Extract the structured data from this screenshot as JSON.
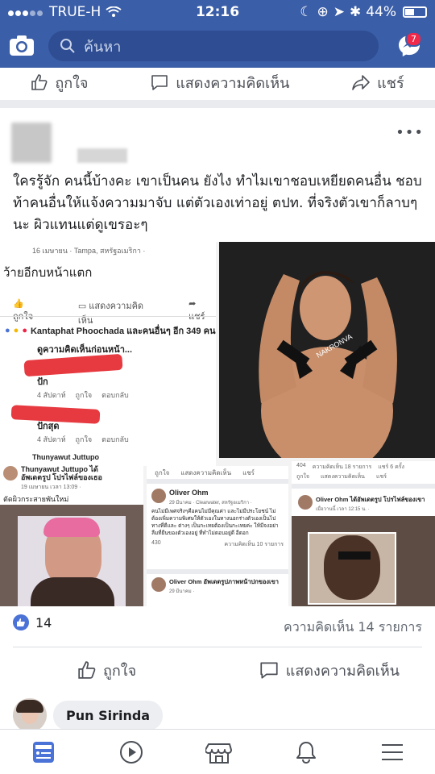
{
  "status": {
    "carrier": "TRUE-H",
    "time": "12:16",
    "battery": "44%"
  },
  "header": {
    "search_placeholder": "ค้นหา",
    "messenger_badge": "7"
  },
  "prev_post_actions": {
    "like": "ถูกใจ",
    "comment": "แสดงความคิดเห็น",
    "share": "แชร์"
  },
  "post": {
    "text": "ใครรู้จัก คนนี้บ้างคะ เขาเป็นคน ยังไง ทำไมเขาชอบเหยียดคนอื่น ชอบท้าคนอื่นให้แจ้งความมาจับ แต่ตัวเองเท่าอยู่ ตปท. ที่จริงตัวเขาก็ลาบๆนะ ผิวแทนแต่ดูเขรอะๆ",
    "more": "•••"
  },
  "collage": {
    "p1_meta": "16 เมษายน · Tampa, สหรัฐอเมริกา ·",
    "p1_text": "ว้ายอีกบหน้าแตก",
    "p1_like": "ถูกใจ",
    "p1_comment": "แสดงความคิดเห็น",
    "p1_share": "แชร์",
    "p1_reactors": "Kantaphat Phoochada และคนอื่นๆ อีก 349 คน",
    "p1_prev": "ดูความคิดเห็นก่อนหน้า...",
    "c1_text": "ปัก",
    "c1_meta": "4 สัปดาห์",
    "c1_like": "ถูกใจ",
    "c1_reply": "ตอบกลับ",
    "c2_text": "ปักสุด",
    "c2_meta": "4 สัปดาห์",
    "c2_like": "ถูกใจ",
    "c2_reply": "ตอบกลับ",
    "next_name": "Thunyawut Juttupo",
    "p3_name": "Thunyawut Juttupo ได้อัพเดตรูป โปรไฟล์ของเธอ",
    "p3_meta": "19 เมษายน เวลา 13:09 ·",
    "p3_caption": "ตัดผิวกระสายพันใหม่",
    "p4_like": "ถูกใจ",
    "p4_comment": "แสดงความคิดเห็น",
    "p4_share": "แชร์",
    "p4_name": "Oliver Ohm",
    "p4_meta": "29 มีนาคม · Clearwater, สหรัฐอเมริกา ·",
    "p4_text": "คนไม่มีเพศจริงๆคือคนไม่มีคุณค่า และไม่มีประโยชน์ ไม่ต้องเพิ่มความพิเศษให้ตัวเองในทางนอกร่างตัวเองเป็นไปทางที่ดีและ ต่างๆ เป็นกะเทยต้องเป็นกะเทยค่ะ ให้มีจงอย่าลืมที่ยืนของตัวเองอยู่ ที่ทำไม่ตอบอยู่ดี อีตอก",
    "p4_reacts": "430",
    "p4_comments": "ความคิดเห็น 10 รายการ",
    "p4b_name": "Oliver Ohm อัพเดตรูปภาพหน้าปกของเขา",
    "p4b_meta": "29 มีนาคม ·",
    "p5_reacts": "404",
    "p5_comments": "ความคิดเห็น 18 รายการ",
    "p5_shares": "แชร์ 6 ครั้ง",
    "p5_like": "ถูกใจ",
    "p5_comment": "แสดงความคิดเห็น",
    "p5_share": "แชร์",
    "p5_name": "Oliver Ohm ได้อัพเดตรูป โปรไฟล์ของเขา",
    "p5_meta": "เมื่อวานนี้ เวลา 12:15 น. ·",
    "logo_text": "NAKRONVA"
  },
  "footer": {
    "like_count": "14",
    "comment_count": "ความคิดเห็น 14 รายการ",
    "like": "ถูกใจ",
    "comment": "แสดงความคิดเห็น",
    "commenter": "Pun Sirinda"
  },
  "colors": {
    "brand": "#3b5ea8",
    "like_blue": "#4b72d6",
    "badge_red": "#f02849"
  }
}
